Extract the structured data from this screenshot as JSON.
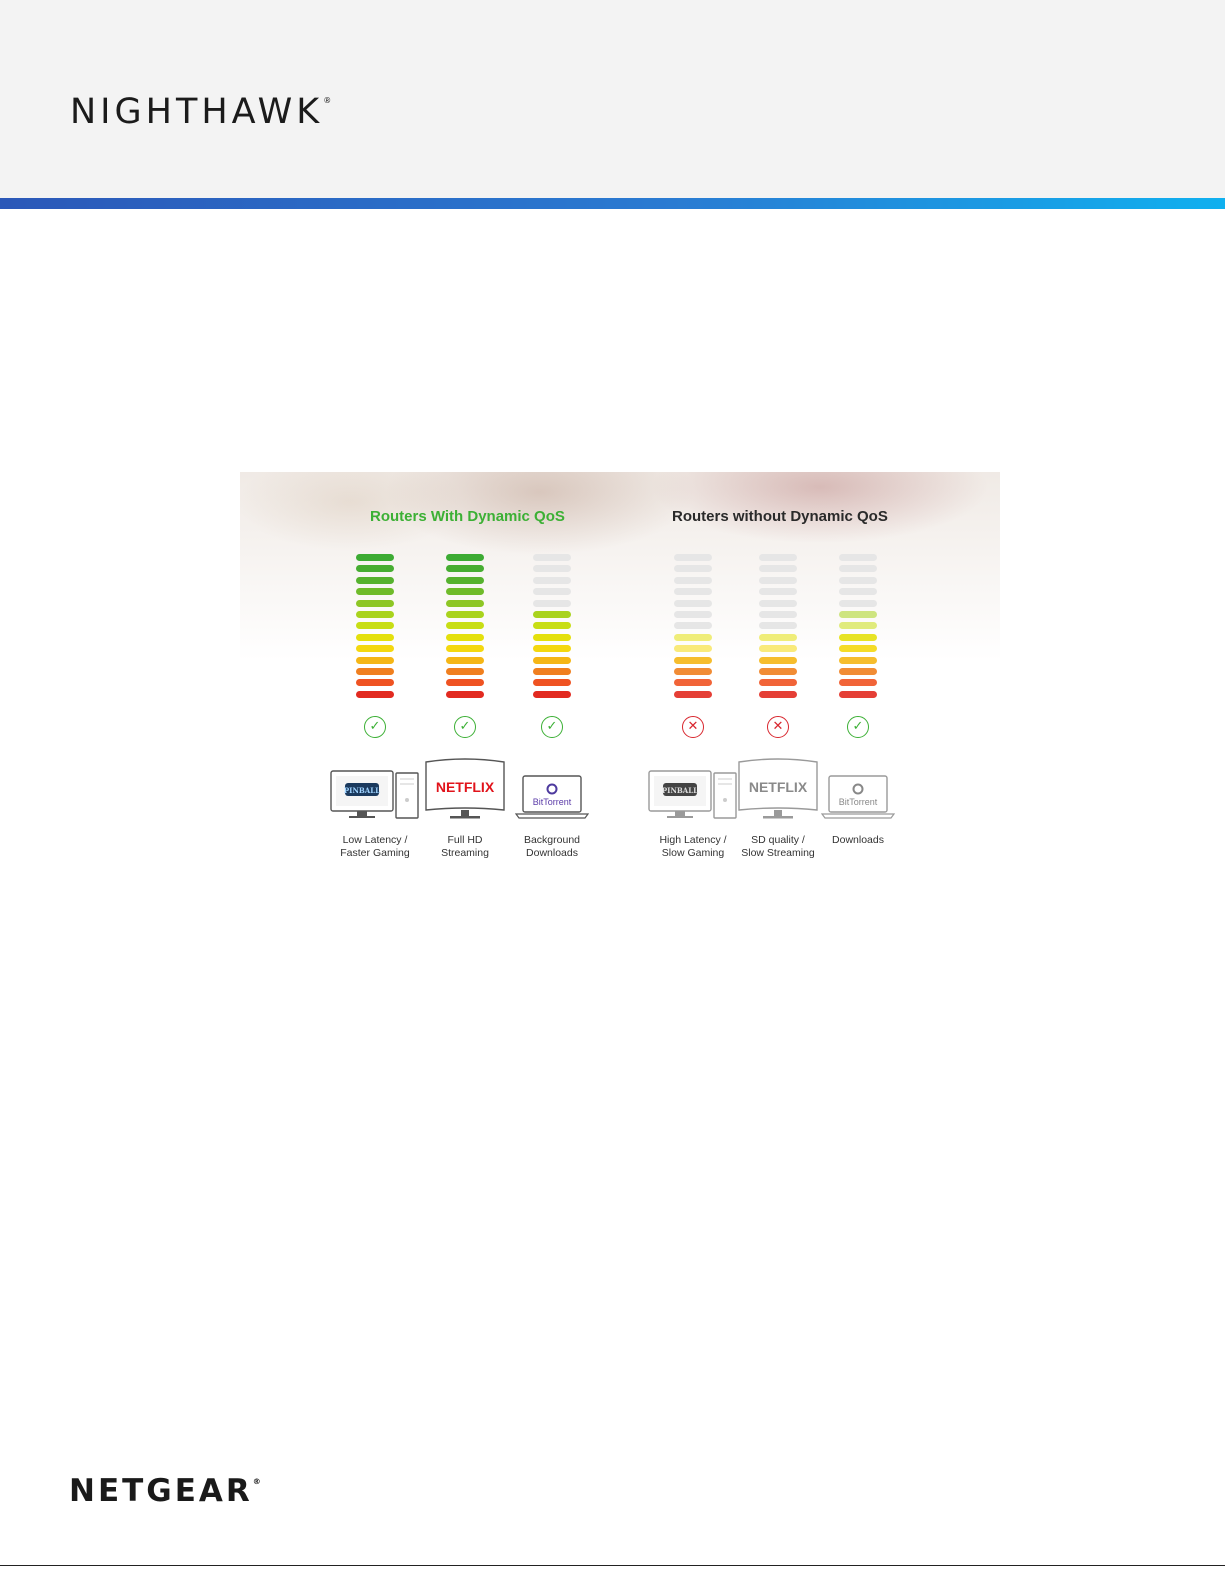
{
  "header": {
    "brand": "NIGHTHAWK",
    "reg": "®"
  },
  "figure": {
    "left_title": "Routers With Dynamic QoS",
    "right_title": "Routers without Dynamic QoS",
    "colors": {
      "good": "#3cb035",
      "bad": "#d8262e",
      "inactive": "#e6e6e6"
    },
    "columns": [
      {
        "caption": "Low Latency /\nFaster Gaming",
        "level": 13,
        "status": "check",
        "device": "desktop-pinball",
        "dim": false,
        "brand": "PINBALL"
      },
      {
        "caption": "Full HD\nStreaming",
        "level": 13,
        "status": "check",
        "device": "tv-netflix",
        "dim": false,
        "brand": "NETFLIX"
      },
      {
        "caption": "Background\nDownloads",
        "level": 8,
        "status": "check",
        "device": "laptop-bittorrent",
        "dim": false,
        "brand": "BitTorrent"
      },
      {
        "caption": "High Latency /\nSlow Gaming",
        "level": 6,
        "status": "cross",
        "device": "desktop-pinball",
        "dim": true,
        "brand": "PINBALL"
      },
      {
        "caption": "SD quality /\nSlow Streaming",
        "level": 6,
        "status": "cross",
        "device": "tv-netflix",
        "dim": true,
        "brand": "NETFLIX"
      },
      {
        "caption": "Downloads",
        "level": 8,
        "status": "check",
        "device": "laptop-bittorrent",
        "dim": true,
        "brand": "BitTorrent"
      }
    ]
  },
  "footer": {
    "brand": "NETGEAR",
    "reg": "®"
  }
}
